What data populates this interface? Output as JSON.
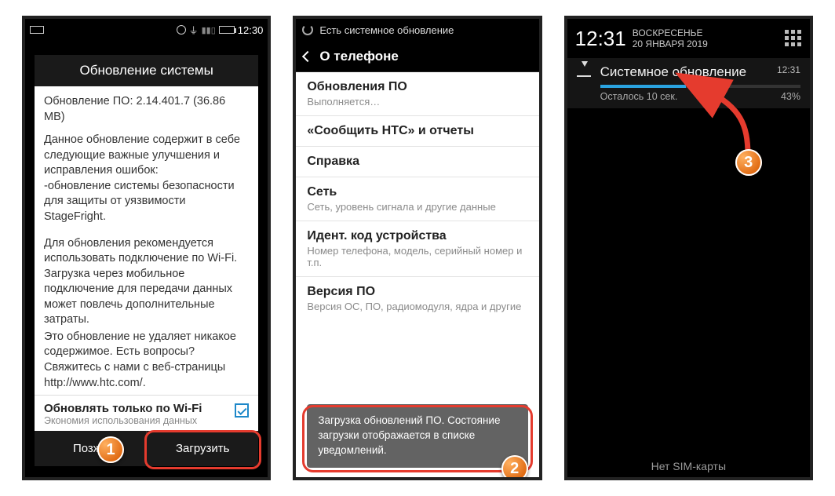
{
  "phone1": {
    "status_time": "12:30",
    "dialog_title": "Обновление системы",
    "version_line": "Обновление ПО: 2.14.401.7 (36.86 MB)",
    "intro": "Данное обновление содержит в себе следующие важные улучшения и исправления ошибок:",
    "bullet": " -обновление системы безопасности для защиты от уязвимости StageFright.",
    "para2": "Для обновления рекомендуется использовать подключение по Wi-Fi. Загрузка через мобильное подключение для передачи данных может повлечь дополнительные затраты.",
    "para3": "Это обновление не удаляет никакое содержимое. Есть вопросы? Свяжитесь с нами с веб-страницы http://www.htc.com/.",
    "wifi_title": "Обновлять только по Wi-Fi",
    "wifi_sub": "Экономия использования данных",
    "btn_later": "Позже",
    "btn_download": "Загрузить"
  },
  "phone2": {
    "status_text": "Есть системное обновление",
    "header": "О телефоне",
    "items": [
      {
        "t": "Обновления ПО",
        "s": "Выполняется…"
      },
      {
        "t": "«Сообщить HTC» и отчеты",
        "s": ""
      },
      {
        "t": "Справка",
        "s": ""
      },
      {
        "t": "Сеть",
        "s": "Сеть, уровень сигнала и другие данные"
      },
      {
        "t": "Идент. код устройства",
        "s": "Номер телефона, модель, серийный номер и т.п."
      },
      {
        "t": "Версия ПО",
        "s": "Версия ОС, ПО, радиомодуля, ядра и другие"
      }
    ],
    "toast": "Загрузка обновлений ПО. Состояние загрузки отображается в списке уведомлений."
  },
  "phone3": {
    "clock": "12:31",
    "weekday": "ВОСКРЕСЕНЬЕ",
    "date": "20 ЯНВАРЯ 2019",
    "notif_title": "Системное обновление",
    "notif_time": "12:31",
    "notif_remaining": "Осталось 10 сек.",
    "notif_percent": "43%",
    "bottom": "Нет SIM-карты"
  },
  "annotations": {
    "b1": "1",
    "b2": "2",
    "b3": "3"
  }
}
